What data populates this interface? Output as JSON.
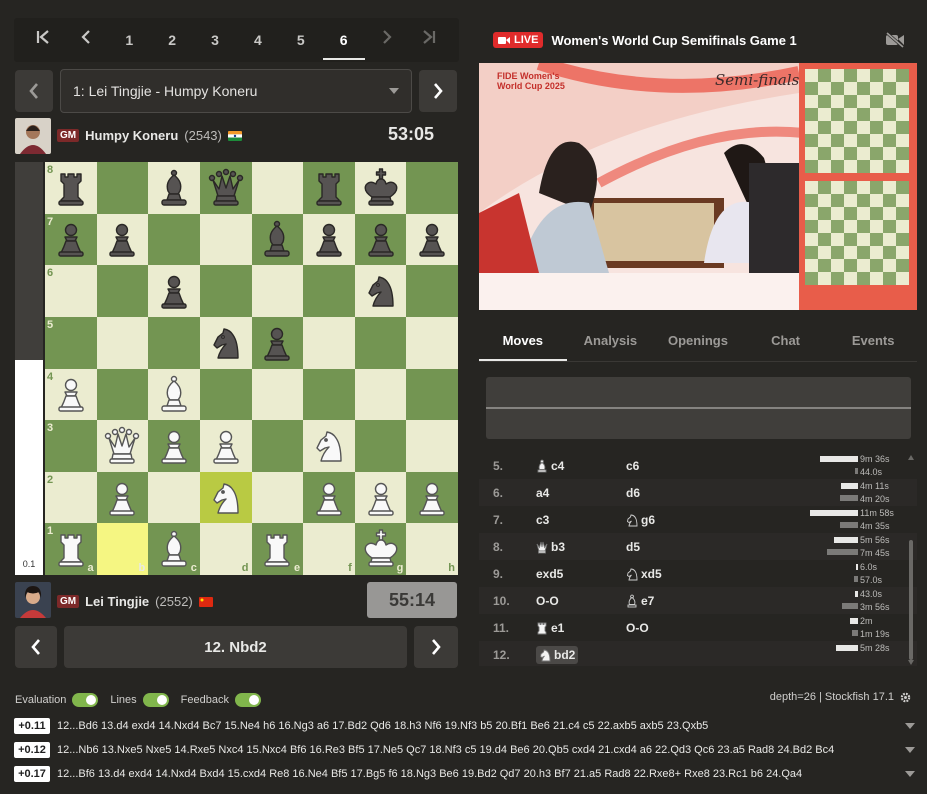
{
  "game_nav": {
    "first_icon": "skip-first-icon",
    "prev_icon": "chevron-left-icon",
    "rounds": [
      "1",
      "2",
      "3",
      "4",
      "5",
      "6"
    ],
    "active_round": "6",
    "next_icon": "chevron-right-icon",
    "last_icon": "skip-last-icon"
  },
  "game_select": {
    "value": "1: Lei Tingjie - Humpy Koneru"
  },
  "top_player": {
    "title": "GM",
    "name": "Humpy Koneru",
    "rating": "(2543)",
    "flag": "india",
    "clock": "53:05"
  },
  "bottom_player": {
    "title": "GM",
    "name": "Lei Tingjie",
    "rating": "(2552)",
    "flag": "china",
    "clock": "55:14"
  },
  "eval": {
    "value": "0.1",
    "white_fraction": 0.52
  },
  "board": {
    "files": [
      "a",
      "b",
      "c",
      "d",
      "e",
      "f",
      "g",
      "h"
    ],
    "ranks": [
      "8",
      "7",
      "6",
      "5",
      "4",
      "3",
      "2",
      "1"
    ],
    "position": [
      [
        "bR",
        "",
        "bB",
        "bQ",
        "",
        "bR",
        "bK",
        ""
      ],
      [
        "bP",
        "bP",
        "",
        "",
        "bB",
        "bP",
        "bP",
        "bP"
      ],
      [
        "",
        "",
        "bP",
        "",
        "",
        "",
        "bN",
        ""
      ],
      [
        "",
        "",
        "",
        "bN",
        "bP",
        "",
        "",
        ""
      ],
      [
        "wP",
        "",
        "wB",
        "",
        "",
        "",
        "",
        ""
      ],
      [
        "",
        "wQ",
        "wP",
        "wP",
        "",
        "wN",
        "",
        ""
      ],
      [
        "",
        "wP",
        "",
        "wN",
        "",
        "wP",
        "wP",
        "wP"
      ],
      [
        "wR",
        "",
        "wB",
        "",
        "wR",
        "",
        "wK",
        ""
      ]
    ],
    "last_move": [
      "b1",
      "d2"
    ]
  },
  "current_move": "12. Nbd2",
  "live": {
    "badge": "LIVE",
    "title": "Women's World Cup Semifinals Game 1",
    "video_off_icon": "video-off-icon"
  },
  "video": {
    "event": "FIDE Women's World Cup 2025",
    "stage": "Semi-finals"
  },
  "tabs": [
    "Moves",
    "Analysis",
    "Openings",
    "Chat",
    "Events"
  ],
  "active_tab": "Moves",
  "moves": [
    {
      "num": "5.",
      "w_piece": "bishop",
      "w": "c4",
      "b_piece": "",
      "b": "c6",
      "w_time": "9m 36s",
      "b_time": "44.0s",
      "w_frac": 0.48,
      "b_frac": 0.04
    },
    {
      "num": "6.",
      "w_piece": "",
      "w": "a4",
      "b_piece": "",
      "b": "d6",
      "w_time": "4m 11s",
      "b_time": "4m 20s",
      "w_frac": 0.21,
      "b_frac": 0.22
    },
    {
      "num": "7.",
      "w_piece": "",
      "w": "c3",
      "b_piece": "knight",
      "b": "g6",
      "w_time": "11m 58s",
      "b_time": "4m 35s",
      "w_frac": 0.6,
      "b_frac": 0.23
    },
    {
      "num": "8.",
      "w_piece": "queen",
      "w": "b3",
      "b_piece": "",
      "b": "d5",
      "w_time": "5m 56s",
      "b_time": "7m 45s",
      "w_frac": 0.3,
      "b_frac": 0.39
    },
    {
      "num": "9.",
      "w_piece": "",
      "w": "exd5",
      "b_piece": "knight",
      "b": "xd5",
      "w_time": "6.0s",
      "b_time": "57.0s",
      "w_frac": 0.01,
      "b_frac": 0.05
    },
    {
      "num": "10.",
      "w_piece": "",
      "w": "O-O",
      "b_piece": "bishop",
      "b": "e7",
      "w_time": "43.0s",
      "b_time": "3m 56s",
      "w_frac": 0.04,
      "b_frac": 0.2
    },
    {
      "num": "11.",
      "w_piece": "rook",
      "w": "e1",
      "b_piece": "",
      "b": "O-O",
      "w_time": "2m",
      "b_time": "1m 19s",
      "w_frac": 0.1,
      "b_frac": 0.07
    },
    {
      "num": "12.",
      "w_piece": "knight",
      "w": "bd2",
      "b_piece": "",
      "b": "",
      "w_time": "5m 28s",
      "b_time": "",
      "w_frac": 0.28,
      "b_frac": 0
    }
  ],
  "engine": {
    "toggles": [
      "Evaluation",
      "Lines",
      "Feedback"
    ],
    "depth": "depth=26 | Stockfish 17.1",
    "lines": [
      {
        "score": "+0.11",
        "moves": "12...Bd6 13.d4 exd4 14.Nxd4 Bc7 15.Ne4 h6 16.Ng3 a6 17.Bd2 Qd6 18.h3 Nf6 19.Nf3 b5 20.Bf1 Be6 21.c4 c5 22.axb5 axb5 23.Qxb5"
      },
      {
        "score": "+0.12",
        "moves": "12...Nb6 13.Nxe5 Nxe5 14.Rxe5 Nxc4 15.Nxc4 Bf6 16.Re3 Bf5 17.Ne5 Qc7 18.Nf3 c5 19.d4 Be6 20.Qb5 cxd4 21.cxd4 a6 22.Qd3 Qc6 23.a5 Rad8 24.Bd2 Bc4"
      },
      {
        "score": "+0.17",
        "moves": "12...Bf6 13.d4 exd4 14.Nxd4 Bxd4 15.cxd4 Re8 16.Ne4 Bf5 17.Bg5 f6 18.Ng3 Be6 19.Bd2 Qd7 20.h3 Bf7 21.a5 Rad8 22.Rxe8+ Rxe8 23.Rc1 b6 24.Qa4"
      }
    ]
  }
}
